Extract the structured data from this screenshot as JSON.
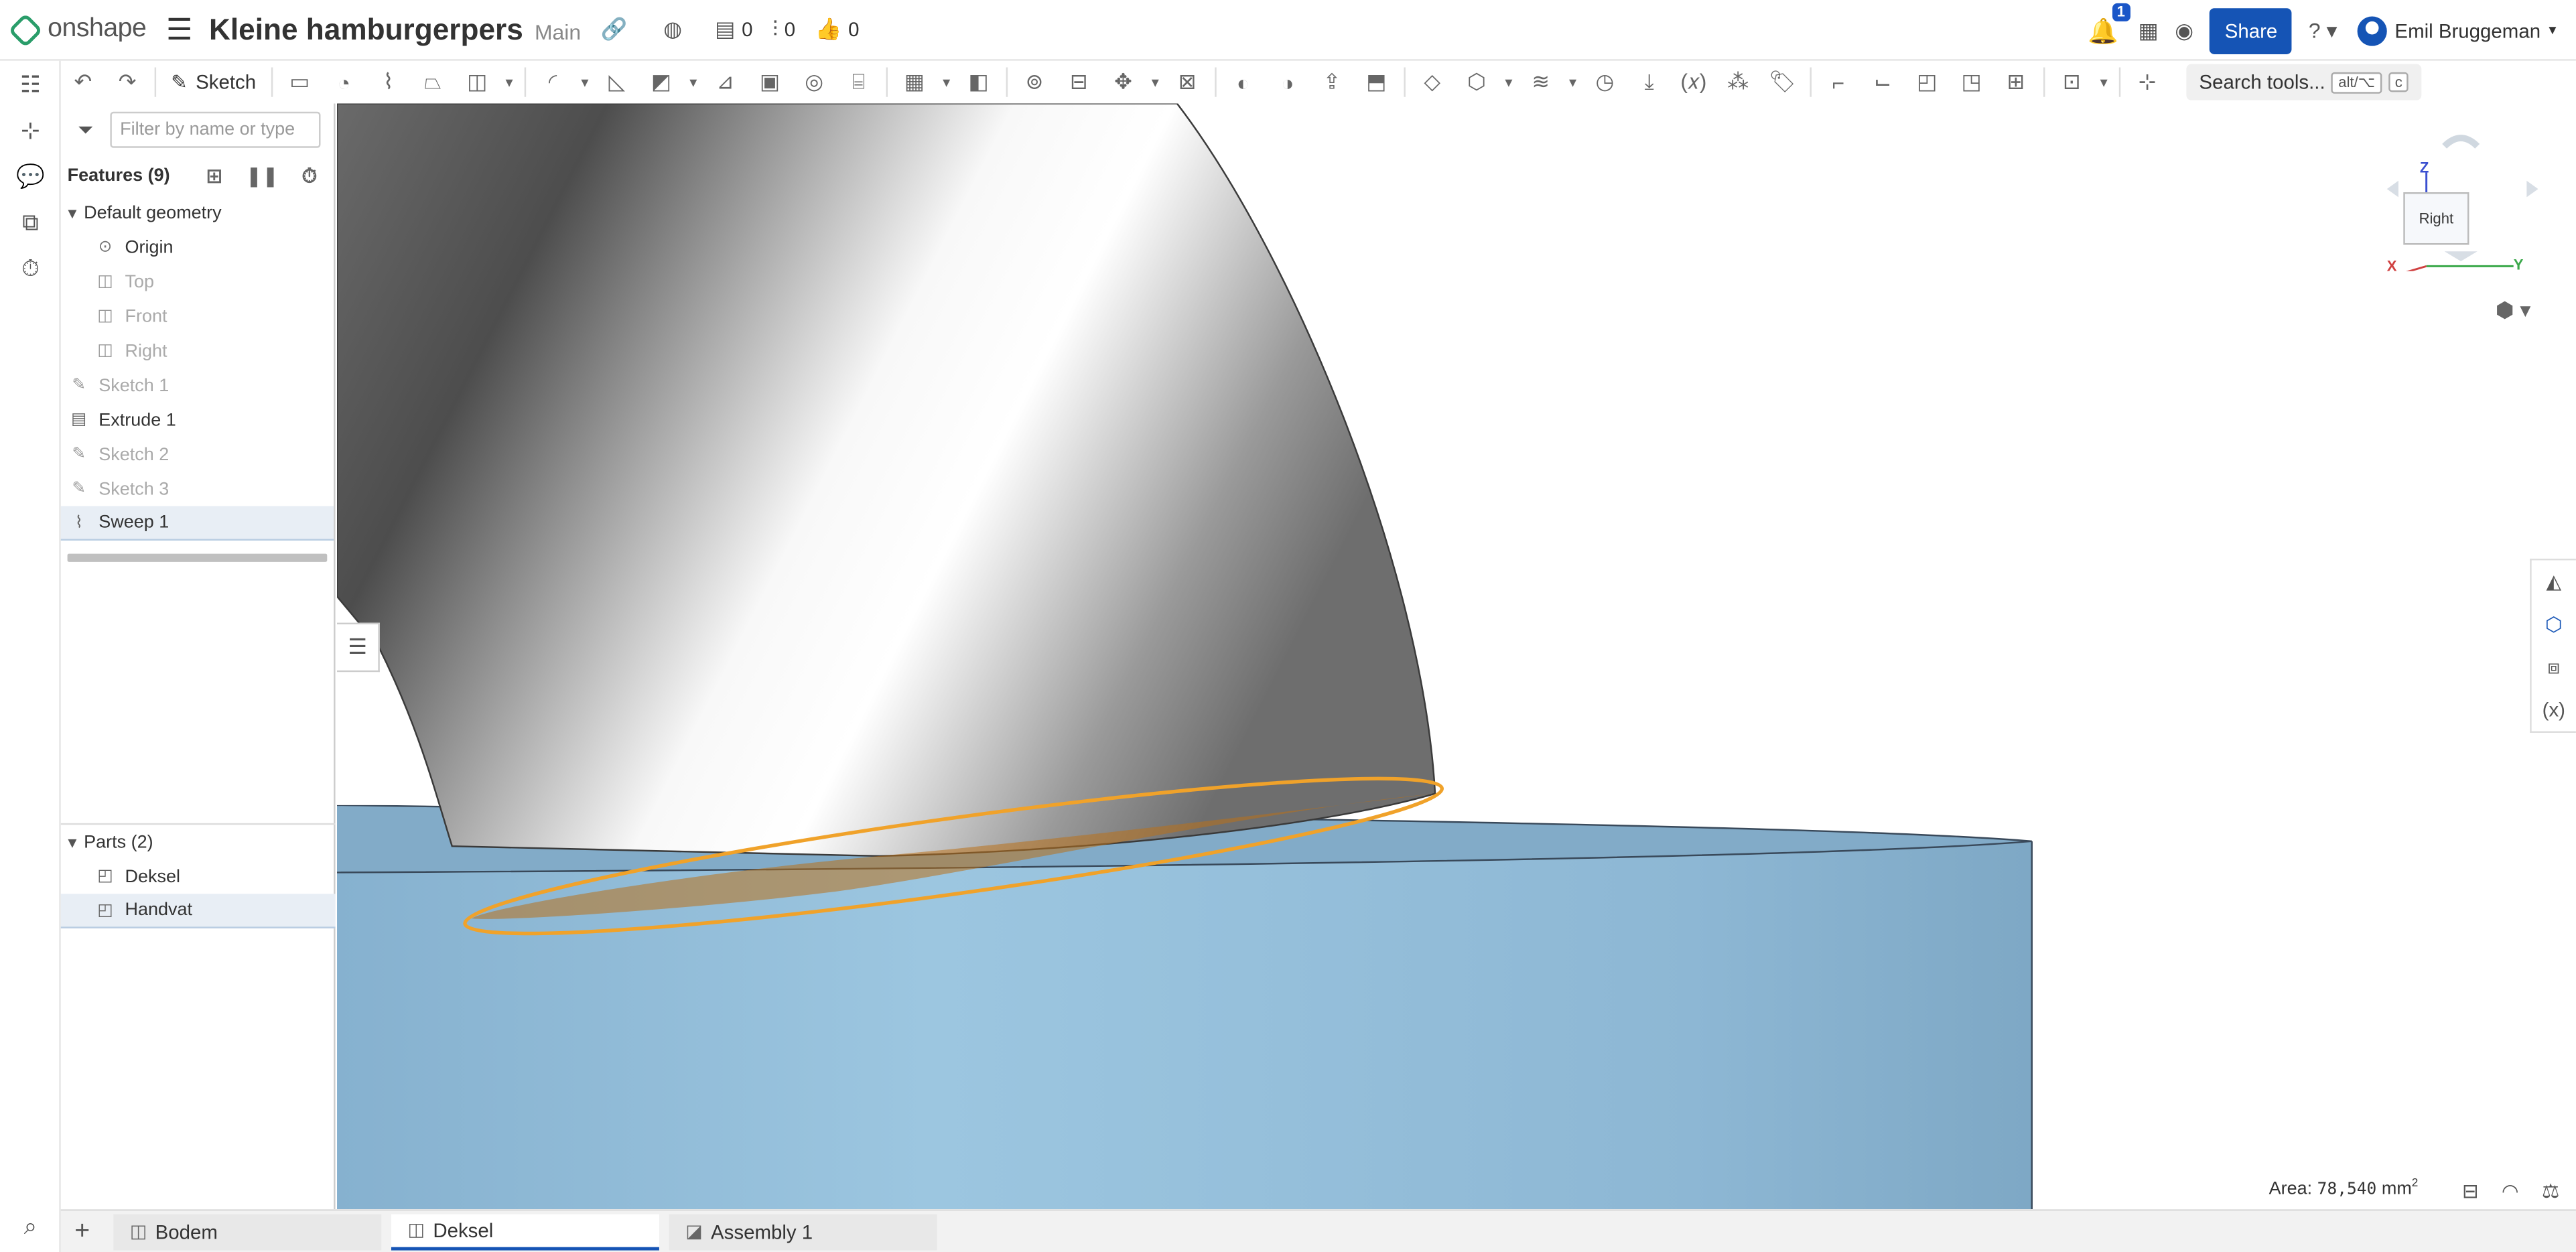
{
  "app": {
    "logo_text": "onshape",
    "doc_title": "Kleine hamburgerpers",
    "branch": "Main"
  },
  "topbar": {
    "counters": [
      {
        "icon": "versions-icon",
        "value": "0"
      },
      {
        "icon": "branch-icon",
        "value": "0"
      },
      {
        "icon": "like-icon",
        "value": "0"
      }
    ],
    "notification_count": "1",
    "share_label": "Share",
    "user_name": "Emil Bruggeman"
  },
  "toolbar": {
    "sketch_label": "Sketch",
    "search_label": "Search tools...",
    "search_kbd": "alt/⌥",
    "search_kbd2": "c"
  },
  "panel": {
    "filter_placeholder": "Filter by name or type",
    "features_label": "Features (9)",
    "default_geometry": "Default geometry",
    "geometry_items": [
      "Origin",
      "Top",
      "Front",
      "Right"
    ],
    "features": [
      "Sketch 1",
      "Extrude 1",
      "Sketch 2",
      "Sketch 3",
      "Sweep 1"
    ],
    "parts_label": "Parts (2)",
    "parts": [
      "Deksel",
      "Handvat"
    ]
  },
  "viewport": {
    "view_cube_face": "Right",
    "axis_z": "Z",
    "axis_x": "X",
    "axis_y": "Y",
    "area_label": "Area:",
    "area_value": "78,540",
    "area_unit": "mm",
    "area_exp": "2",
    "colors": {
      "cylinder": "#8fb9d6",
      "selection": "#f0a22a",
      "sweep_light": "#ffffff",
      "sweep_dark": "#4d4d4d"
    }
  },
  "tabs": [
    {
      "label": "Bodem",
      "active": false
    },
    {
      "label": "Deksel",
      "active": true
    },
    {
      "label": "Assembly 1",
      "active": false
    }
  ]
}
